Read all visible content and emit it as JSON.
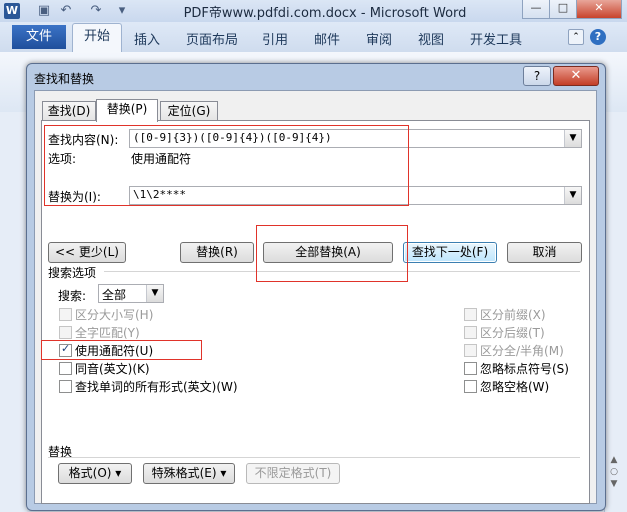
{
  "app": {
    "title": "PDF帝www.pdfdi.com.docx - Microsoft Word",
    "word_icon": "W",
    "file_tab": "文件",
    "tabs": [
      "开始",
      "插入",
      "页面布局",
      "引用",
      "邮件",
      "审阅",
      "视图",
      "开发工具"
    ],
    "win_buttons": {
      "min": "—",
      "max": "□",
      "close": "✕"
    }
  },
  "dialog": {
    "title": "查找和替换",
    "help": "?",
    "close": "✕",
    "tabs": {
      "find": "查找(D)",
      "replace": "替换(P)",
      "goto": "定位(G)"
    },
    "find_label": "查找内容(N):",
    "find_value": "([0-9]{3})([0-9]{4})([0-9]{4})",
    "options_label": "选项:",
    "options_value": "使用通配符",
    "replace_label": "替换为(I):",
    "replace_value": "\\1\\2****",
    "buttons": {
      "less": "<< 更少(L)",
      "replace": "替换(R)",
      "replace_all": "全部替换(A)",
      "find_next": "查找下一处(F)",
      "cancel": "取消"
    },
    "search_options_title": "搜索选项",
    "search_label": "搜索:",
    "search_value": "全部",
    "left_options": [
      {
        "label": "区分大小写(H)",
        "checked": false,
        "enabled": false
      },
      {
        "label": "全字匹配(Y)",
        "checked": false,
        "enabled": false
      },
      {
        "label": "使用通配符(U)",
        "checked": true,
        "enabled": true
      },
      {
        "label": "同音(英文)(K)",
        "checked": false,
        "enabled": true
      },
      {
        "label": "查找单词的所有形式(英文)(W)",
        "checked": false,
        "enabled": true
      }
    ],
    "right_options": [
      {
        "label": "区分前缀(X)",
        "checked": false,
        "enabled": false
      },
      {
        "label": "区分后缀(T)",
        "checked": false,
        "enabled": false
      },
      {
        "label": "区分全/半角(M)",
        "checked": false,
        "enabled": false
      },
      {
        "label": "忽略标点符号(S)",
        "checked": false,
        "enabled": true
      },
      {
        "label": "忽略空格(W)",
        "checked": false,
        "enabled": true
      }
    ],
    "replace_section_title": "替换",
    "format_button": "格式(O) ▾",
    "special_button": "特殊格式(E) ▾",
    "no_format_button": "不限定格式(T)"
  },
  "colors": {
    "annotation": "#e0332a",
    "accent": "#2b5797"
  }
}
